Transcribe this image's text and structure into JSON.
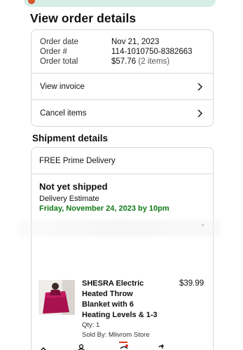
{
  "header": {
    "title": "View order details"
  },
  "order": {
    "rows": [
      {
        "label": "Order date",
        "value": "Nov 21, 2023",
        "extra": ""
      },
      {
        "label": "Order #",
        "value": "114-1010750-8382663",
        "extra": ""
      },
      {
        "label": "Order total",
        "value": "$57.76",
        "extra": "(2 items)"
      }
    ],
    "invoice_label": "View invoice",
    "cancel_label": "Cancel items"
  },
  "shipment": {
    "title": "Shipment details",
    "delivery_type": "FREE Prime Delivery",
    "status": "Not yet shipped",
    "estimate_label": "Delivery Estimate",
    "estimate_date": "Friday, November 24, 2023 by 10pm"
  },
  "product": {
    "title": "SHESRA Electric Heated Throw Blanket with 6 Heating Levels & 1-3",
    "price": "$39.99",
    "qty": "Qty: 1",
    "sold_by": "Sold By: Mlivrom Store"
  },
  "colors": {
    "accent_green": "#117a17",
    "border": "#d5d9d9",
    "banner": "#d7eee7",
    "nav_badge": "#e3362a"
  }
}
